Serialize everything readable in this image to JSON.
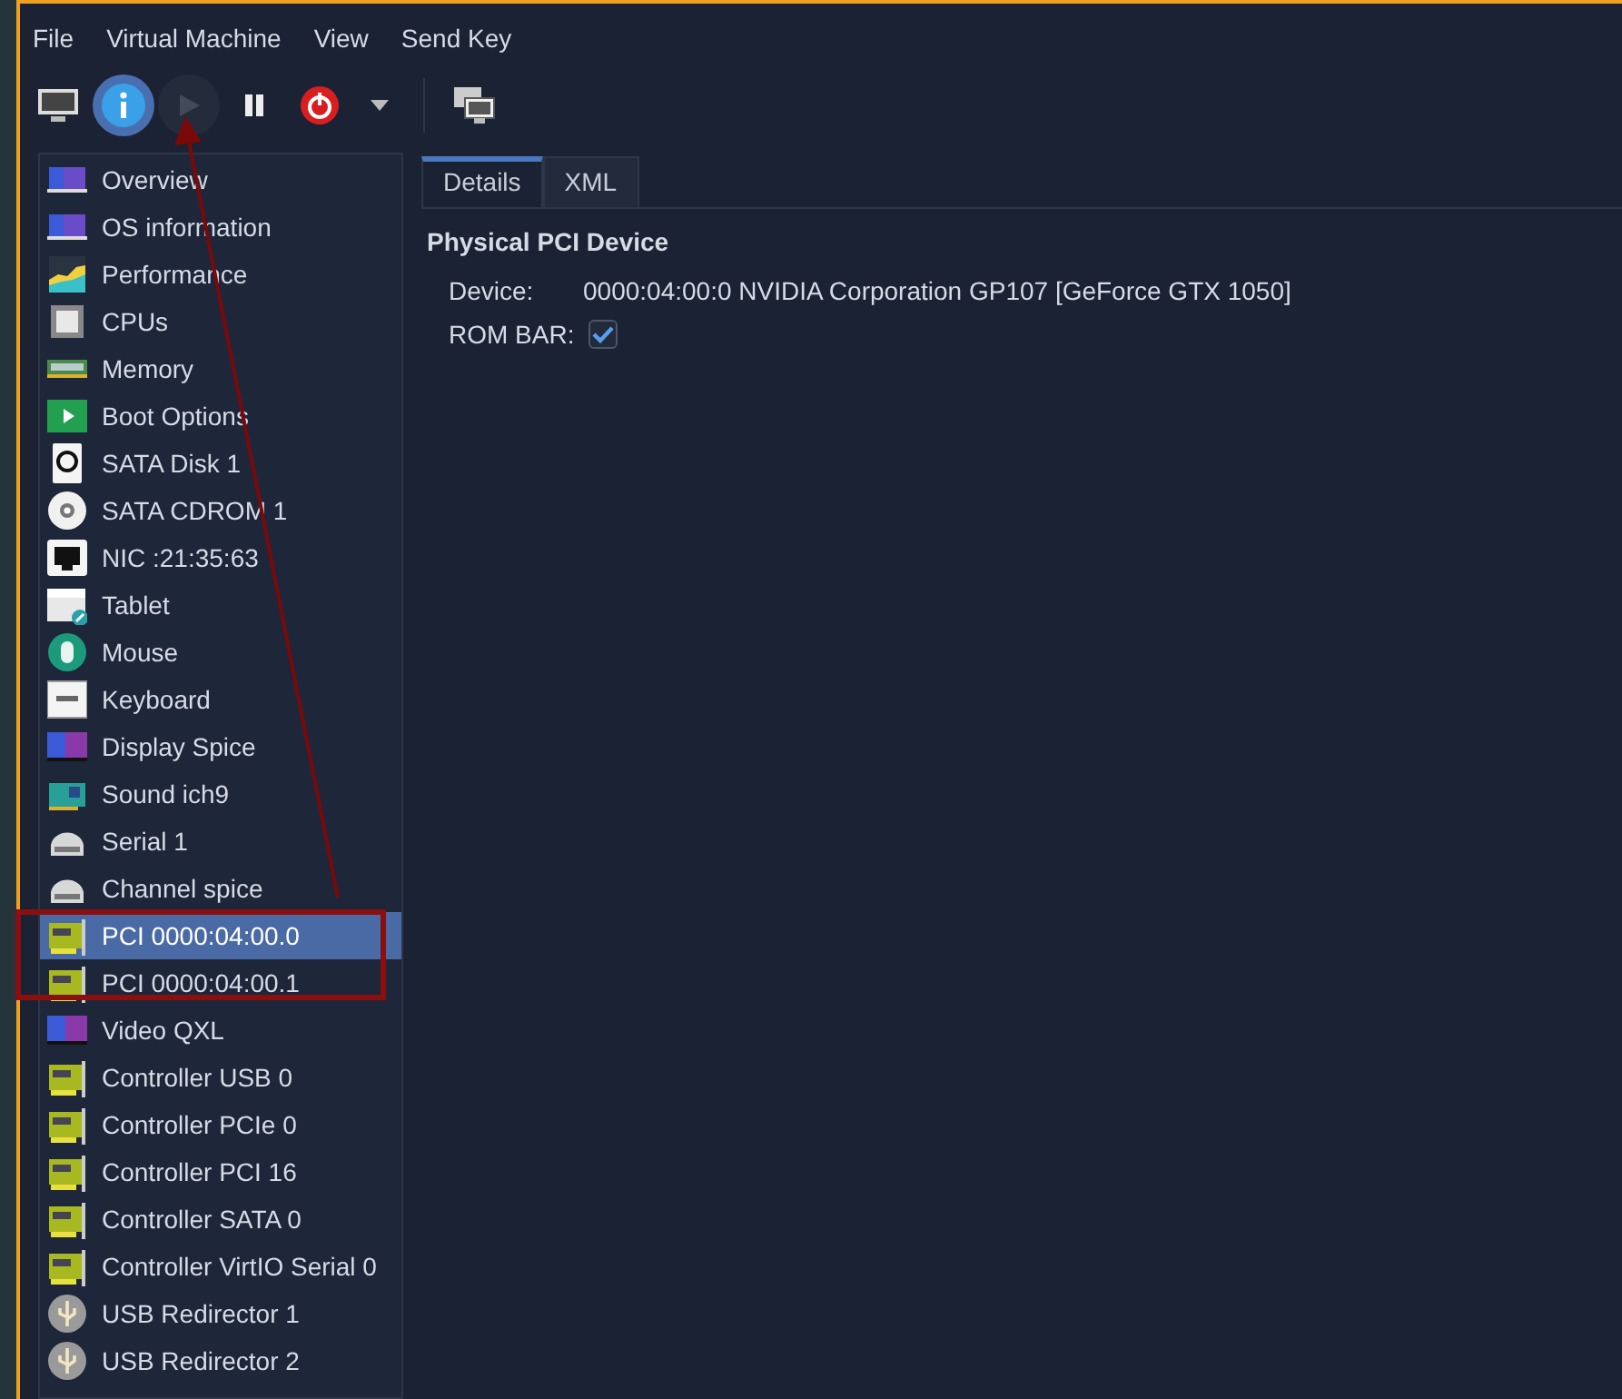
{
  "menu": [
    "File",
    "Virtual Machine",
    "View",
    "Send Key"
  ],
  "toolbar": [
    {
      "kind": "console",
      "selected": false,
      "disabled": false
    },
    {
      "kind": "info",
      "selected": true,
      "disabled": false
    },
    {
      "kind": "run",
      "selected": false,
      "disabled": true
    },
    {
      "kind": "pause",
      "selected": false,
      "disabled": false
    },
    {
      "kind": "shutdown",
      "selected": false,
      "disabled": false
    },
    {
      "kind": "caret",
      "selected": false,
      "disabled": false
    },
    {
      "kind": "separator"
    },
    {
      "kind": "screens",
      "selected": false,
      "disabled": false
    }
  ],
  "sidebar": {
    "items": [
      {
        "label": "Overview",
        "kind": "monitor",
        "selected": false
      },
      {
        "label": "OS information",
        "kind": "monitor",
        "selected": false
      },
      {
        "label": "Performance",
        "kind": "chart",
        "selected": false
      },
      {
        "label": "CPUs",
        "kind": "chip",
        "selected": false
      },
      {
        "label": "Memory",
        "kind": "ram",
        "selected": false
      },
      {
        "label": "Boot Options",
        "kind": "boot",
        "selected": false
      },
      {
        "label": "SATA Disk 1",
        "kind": "disk",
        "selected": false
      },
      {
        "label": "SATA CDROM 1",
        "kind": "cdrom",
        "selected": false
      },
      {
        "label": "NIC :21:35:63",
        "kind": "nic",
        "selected": false
      },
      {
        "label": "Tablet",
        "kind": "tablet",
        "selected": false
      },
      {
        "label": "Mouse",
        "kind": "mouse",
        "selected": false
      },
      {
        "label": "Keyboard",
        "kind": "keyboard",
        "selected": false
      },
      {
        "label": "Display Spice",
        "kind": "display",
        "selected": false
      },
      {
        "label": "Sound ich9",
        "kind": "sound",
        "selected": false
      },
      {
        "label": "Serial 1",
        "kind": "serial",
        "selected": false
      },
      {
        "label": "Channel spice",
        "kind": "serial",
        "selected": false
      },
      {
        "label": "PCI 0000:04:00.0",
        "kind": "pci",
        "selected": true
      },
      {
        "label": "PCI 0000:04:00.1",
        "kind": "pci",
        "selected": false
      },
      {
        "label": "Video QXL",
        "kind": "display",
        "selected": false
      },
      {
        "label": "Controller USB 0",
        "kind": "pci",
        "selected": false
      },
      {
        "label": "Controller PCIe 0",
        "kind": "pci",
        "selected": false
      },
      {
        "label": "Controller PCI 16",
        "kind": "pci",
        "selected": false
      },
      {
        "label": "Controller SATA 0",
        "kind": "pci",
        "selected": false
      },
      {
        "label": "Controller VirtIO Serial 0",
        "kind": "pci",
        "selected": false
      },
      {
        "label": "USB Redirector 1",
        "kind": "usb",
        "selected": false
      },
      {
        "label": "USB Redirector 2",
        "kind": "usb",
        "selected": false
      }
    ]
  },
  "tabs": [
    {
      "label": "Details",
      "selected": true
    },
    {
      "label": "XML",
      "selected": false
    }
  ],
  "details": {
    "heading": "Physical PCI Device",
    "device_label": "Device:",
    "device_value": "0000:04:00:0 NVIDIA Corporation GP107 [GeForce GTX 1050]",
    "rombar_label": "ROM BAR:",
    "rombar_checked": true
  },
  "annotations": {
    "highlight_box": true,
    "arrow": true
  }
}
